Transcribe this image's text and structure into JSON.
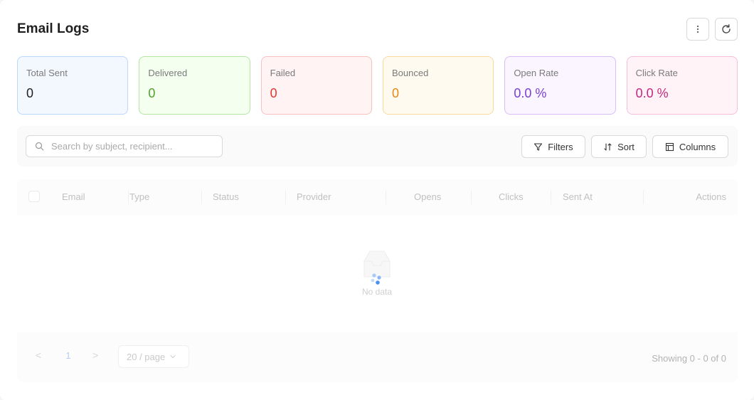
{
  "header": {
    "title": "Email Logs"
  },
  "stats": [
    {
      "label": "Total Sent",
      "value": "0",
      "value_color": "#1f1f1f",
      "bg": "#f3f8ff",
      "border": "#b9d8fa"
    },
    {
      "label": "Delivered",
      "value": "0",
      "value_color": "#52a02a",
      "bg": "#f4fff0",
      "border": "#b4e5a2"
    },
    {
      "label": "Failed",
      "value": "0",
      "value_color": "#e2382f",
      "bg": "#fff3f3",
      "border": "#f7c1bf"
    },
    {
      "label": "Bounced",
      "value": "0",
      "value_color": "#e58a12",
      "bg": "#fffaf0",
      "border": "#fbd89c"
    },
    {
      "label": "Open Rate",
      "value": "0.0 %",
      "value_color": "#7a3fd0",
      "bg": "#faf5ff",
      "border": "#d8bdf6"
    },
    {
      "label": "Click Rate",
      "value": "0.0 %",
      "value_color": "#c12a7e",
      "bg": "#fff3f8",
      "border": "#f6bedb"
    }
  ],
  "toolbar": {
    "search_placeholder": "Search by subject, recipient...",
    "filters_label": "Filters",
    "sort_label": "Sort",
    "columns_label": "Columns"
  },
  "table": {
    "columns": [
      "Email",
      "Type",
      "Status",
      "Provider",
      "Opens",
      "Clicks",
      "Sent At",
      "Actions"
    ],
    "empty_text": "No data"
  },
  "pagination": {
    "prev": "<",
    "current_page": "1",
    "next": ">",
    "page_size": "20 / page",
    "showing": "Showing 0 - 0 of 0"
  },
  "colors": {
    "accent": "#1677ff"
  }
}
